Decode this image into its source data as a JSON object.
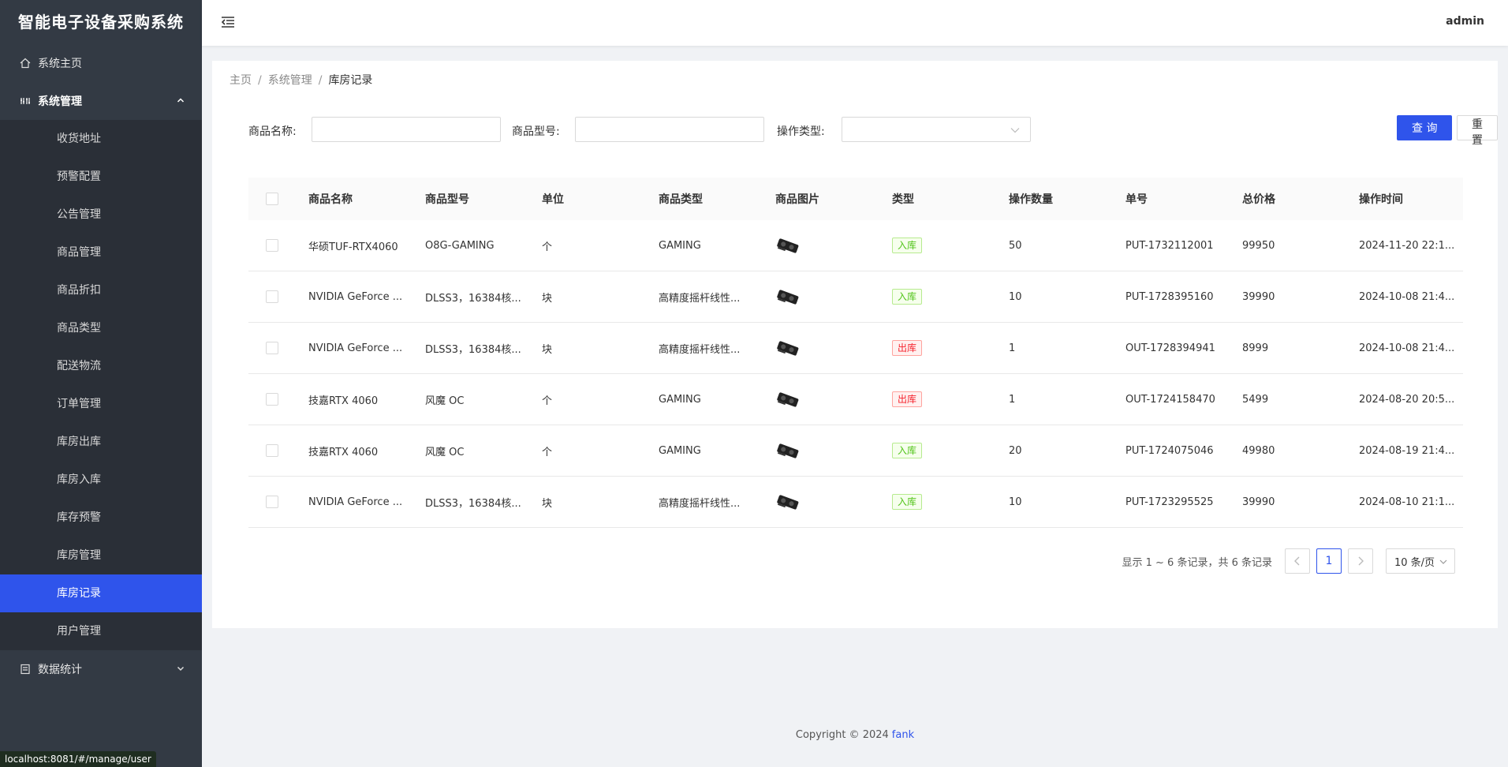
{
  "sidebar": {
    "brand": "智能电子设备采购系统",
    "items": [
      {
        "label": "系统主页",
        "icon": "home-icon"
      },
      {
        "label": "系统管理",
        "icon": "system-icon"
      },
      {
        "label": "数据统计",
        "icon": "stats-icon"
      }
    ],
    "submenu": [
      "收货地址",
      "预警配置",
      "公告管理",
      "商品管理",
      "商品折扣",
      "商品类型",
      "配送物流",
      "订单管理",
      "库房出库",
      "库房入库",
      "库存预警",
      "库房管理",
      "库房记录",
      "用户管理"
    ],
    "active_submenu": "库房记录"
  },
  "status_url": "localhost:8081/#/manage/user",
  "header": {
    "user": "admin"
  },
  "breadcrumb": {
    "home": "主页",
    "section": "系统管理",
    "current": "库房记录"
  },
  "search": {
    "name_label": "商品名称:",
    "model_label": "商品型号:",
    "type_label": "操作类型:",
    "query_button": "查 询",
    "reset_button": "重 置"
  },
  "table": {
    "columns": [
      "商品名称",
      "商品型号",
      "单位",
      "商品类型",
      "商品图片",
      "类型",
      "操作数量",
      "单号",
      "总价格",
      "操作时间"
    ],
    "rows": [
      {
        "name": "华硕TUF-RTX4060",
        "model": "O8G-GAMING",
        "unit": "个",
        "category": "GAMING",
        "type": "入库",
        "qty": "50",
        "order": "PUT-1732112001",
        "price": "99950",
        "time": "2024-11-20 22:1..."
      },
      {
        "name": "NVIDIA GeForce ...",
        "model": "DLSS3，16384核...",
        "unit": "块",
        "category": "高精度摇杆线性...",
        "type": "入库",
        "qty": "10",
        "order": "PUT-1728395160",
        "price": "39990",
        "time": "2024-10-08 21:4..."
      },
      {
        "name": "NVIDIA GeForce ...",
        "model": "DLSS3，16384核...",
        "unit": "块",
        "category": "高精度摇杆线性...",
        "type": "出库",
        "qty": "1",
        "order": "OUT-1728394941",
        "price": "8999",
        "time": "2024-10-08 21:4..."
      },
      {
        "name": "技嘉RTX 4060",
        "model": "风魔 OC",
        "unit": "个",
        "category": "GAMING",
        "type": "出库",
        "qty": "1",
        "order": "OUT-1724158470",
        "price": "5499",
        "time": "2024-08-20 20:5..."
      },
      {
        "name": "技嘉RTX 4060",
        "model": "风魔 OC",
        "unit": "个",
        "category": "GAMING",
        "type": "入库",
        "qty": "20",
        "order": "PUT-1724075046",
        "price": "49980",
        "time": "2024-08-19 21:4..."
      },
      {
        "name": "NVIDIA GeForce ...",
        "model": "DLSS3，16384核...",
        "unit": "块",
        "category": "高精度摇杆线性...",
        "type": "入库",
        "qty": "10",
        "order": "PUT-1723295525",
        "price": "39990",
        "time": "2024-08-10 21:1..."
      }
    ]
  },
  "pagination": {
    "summary": "显示 1 ~ 6 条记录，共 6 条记录",
    "current": "1",
    "page_size": "10 条/页"
  },
  "footer": {
    "copyright": "Copyright © 2024",
    "author": "fank"
  },
  "colors": {
    "primary": "#2f54eb",
    "sidebar_bg": "#333a44",
    "submenu_bg": "#2a2f37"
  }
}
